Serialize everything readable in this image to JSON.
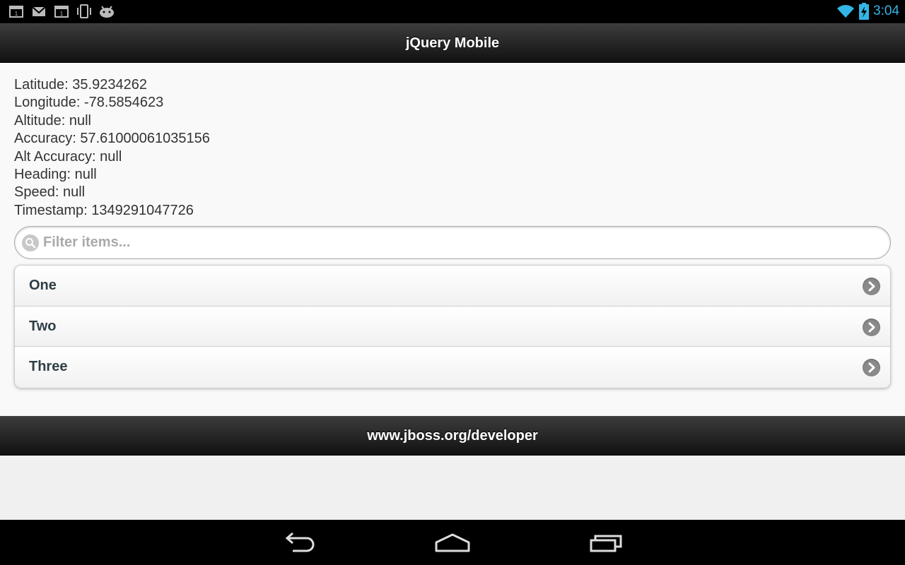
{
  "status_bar": {
    "time": "3:04",
    "notification_icons": [
      "calendar-icon",
      "gmail-icon",
      "calendar-icon",
      "vibrate-icon",
      "android-icon"
    ],
    "wifi_icon": "wifi-icon",
    "battery_icon": "battery-charging-icon",
    "accent_color": "#33b5e5"
  },
  "header": {
    "title": "jQuery Mobile"
  },
  "geolocation": {
    "latitude": "Latitude: 35.9234262",
    "longitude": "Longitude: -78.5854623",
    "altitude": "Altitude: null",
    "accuracy": "Accuracy: 57.61000061035156",
    "alt_accuracy": "Alt Accuracy: null",
    "heading": "Heading: null",
    "speed": "Speed: null",
    "timestamp": "Timestamp: 1349291047726"
  },
  "filter": {
    "placeholder": "Filter items...",
    "icon": "search-icon"
  },
  "list": {
    "items": [
      {
        "label": "One",
        "icon": "arrow-right-icon"
      },
      {
        "label": "Two",
        "icon": "arrow-right-icon"
      },
      {
        "label": "Three",
        "icon": "arrow-right-icon"
      }
    ]
  },
  "footer": {
    "title": "www.jboss.org/developer"
  },
  "nav_bar": {
    "buttons": [
      "back-icon",
      "home-icon",
      "recent-apps-icon"
    ]
  }
}
